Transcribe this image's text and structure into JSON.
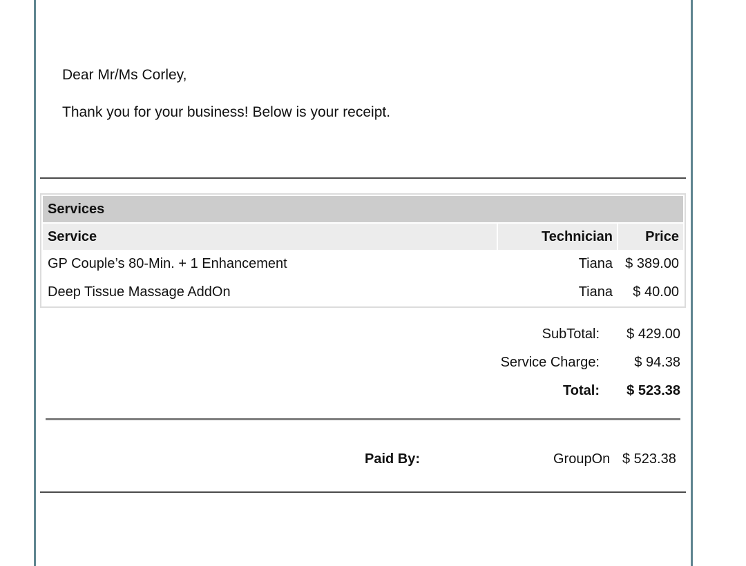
{
  "letter": {
    "greeting": "Dear Mr/Ms Corley,",
    "intro": "Thank you for your business! Below is your receipt."
  },
  "services": {
    "section_title": "Services",
    "columns": {
      "service": "Service",
      "technician": "Technician",
      "price": "Price"
    },
    "rows": [
      {
        "service": "GP Couple’s 80-Min. + 1 Enhancement",
        "technician": "Tiana",
        "price": "$ 389.00"
      },
      {
        "service": "Deep Tissue Massage AddOn",
        "technician": "Tiana",
        "price": "$ 40.00"
      }
    ]
  },
  "totals": {
    "subtotal_label": "SubTotal:",
    "subtotal_value": "$ 429.00",
    "service_charge_label": "Service Charge:",
    "service_charge_value": "$ 94.38",
    "total_label": "Total:",
    "total_value": "$ 523.38"
  },
  "payment": {
    "label": "Paid By:",
    "method": "GroupOn",
    "amount": "$ 523.38"
  },
  "colors": {
    "frame_border": "#5f8590",
    "section_header_bg": "#cccccc",
    "column_header_bg": "#ececec"
  }
}
